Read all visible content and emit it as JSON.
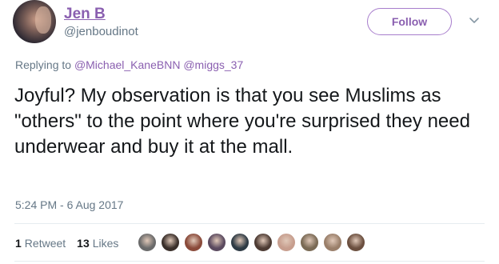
{
  "user": {
    "display_name": "Jen B",
    "handle": "@jenboudinot"
  },
  "follow_label": "Follow",
  "reply": {
    "prefix": "Replying to",
    "mentions": [
      "@Michael_KaneBNN",
      "@miggs_37"
    ]
  },
  "tweet_text": "Joyful? My observation is that you see Muslims as \"others\" to the point where you're surprised they need underwear and buy it at the mall.",
  "timestamp": "5:24 PM - 6 Aug 2017",
  "stats": {
    "retweets_count": "1",
    "retweets_label": "Retweet",
    "likes_count": "13",
    "likes_label": "Likes"
  },
  "likers": [
    {
      "icon": "cat-avatar",
      "color": "#6a6a6a"
    },
    {
      "icon": "avatar",
      "color": "#3a2f2a"
    },
    {
      "icon": "avatar",
      "color": "#8a4a3a"
    },
    {
      "icon": "avatar",
      "color": "#5b4a5f"
    },
    {
      "icon": "avatar",
      "color": "#2e3a44"
    },
    {
      "icon": "avatar",
      "color": "#4d3b33"
    },
    {
      "icon": "avatar",
      "color": "#c79e8e"
    },
    {
      "icon": "avatar",
      "color": "#7a6a55"
    },
    {
      "icon": "avatar",
      "color": "#9a7f6a"
    },
    {
      "icon": "avatar",
      "color": "#6b4f3f"
    }
  ],
  "colors": {
    "accent": "#8a5fb0",
    "secondary_text": "#657786",
    "primary_text": "#14171a"
  }
}
